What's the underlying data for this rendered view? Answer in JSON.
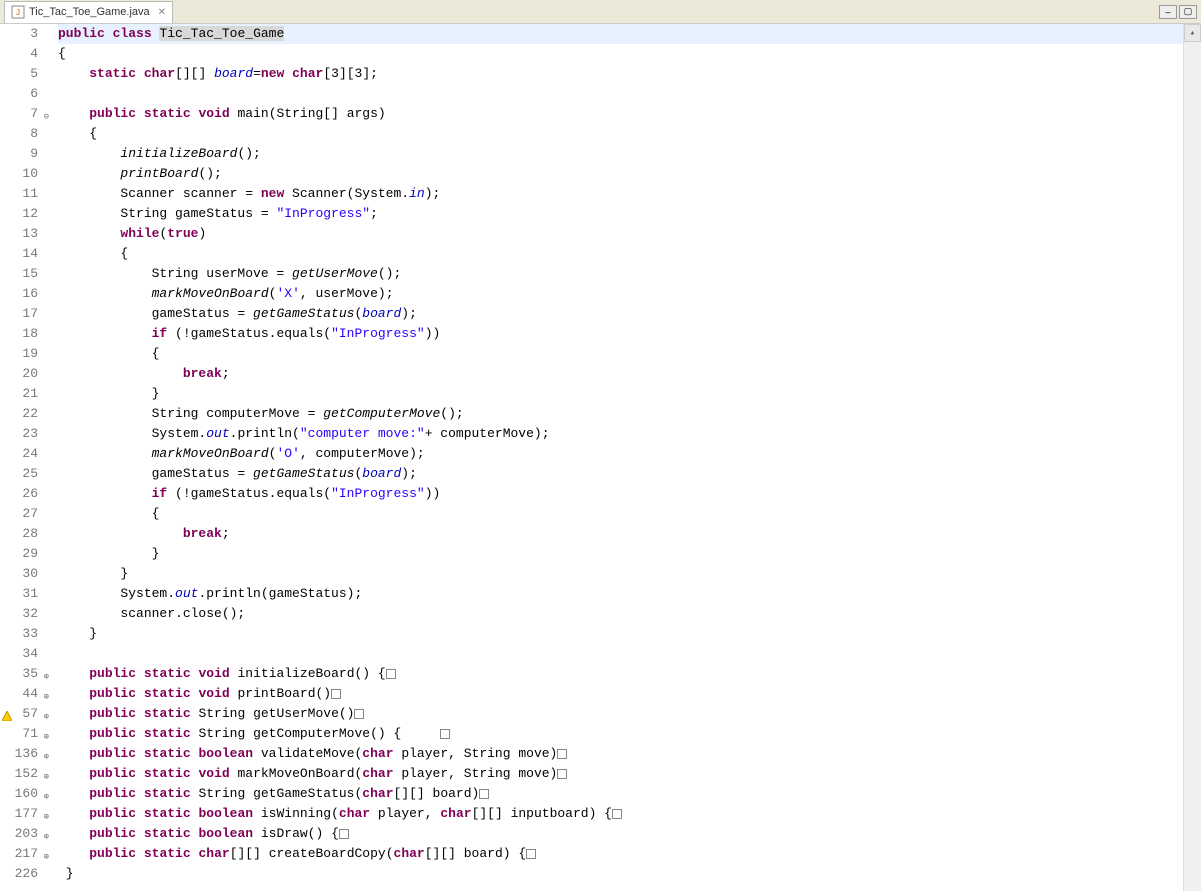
{
  "tab": {
    "title": "Tic_Tac_Toe_Game.java"
  },
  "code": {
    "lines": [
      {
        "n": "3",
        "fold": "",
        "hl": true,
        "tokens": [
          {
            "t": "public",
            "c": "kw"
          },
          {
            "t": " "
          },
          {
            "t": "class",
            "c": "kw"
          },
          {
            "t": " "
          },
          {
            "t": "Tic_Tac_Toe_Game",
            "c": "sel"
          }
        ]
      },
      {
        "n": "4",
        "tokens": [
          {
            "t": "{"
          }
        ]
      },
      {
        "n": "5",
        "tokens": [
          {
            "t": "    "
          },
          {
            "t": "static",
            "c": "kw"
          },
          {
            "t": " "
          },
          {
            "t": "char",
            "c": "kw"
          },
          {
            "t": "[][] "
          },
          {
            "t": "board",
            "c": "fld"
          },
          {
            "t": "="
          },
          {
            "t": "new",
            "c": "kw"
          },
          {
            "t": " "
          },
          {
            "t": "char",
            "c": "kw"
          },
          {
            "t": "[3][3];"
          }
        ]
      },
      {
        "n": "6",
        "tokens": [
          {
            "t": ""
          }
        ]
      },
      {
        "n": "7",
        "fold": "open",
        "tokens": [
          {
            "t": "    "
          },
          {
            "t": "public",
            "c": "kw"
          },
          {
            "t": " "
          },
          {
            "t": "static",
            "c": "kw"
          },
          {
            "t": " "
          },
          {
            "t": "void",
            "c": "kw"
          },
          {
            "t": " main(String[] args)"
          }
        ]
      },
      {
        "n": "8",
        "tokens": [
          {
            "t": "    {"
          }
        ]
      },
      {
        "n": "9",
        "tokens": [
          {
            "t": "        "
          },
          {
            "t": "initializeBoard",
            "c": "mtdi"
          },
          {
            "t": "();"
          }
        ]
      },
      {
        "n": "10",
        "tokens": [
          {
            "t": "        "
          },
          {
            "t": "printBoard",
            "c": "mtdi"
          },
          {
            "t": "();"
          }
        ]
      },
      {
        "n": "11",
        "tokens": [
          {
            "t": "        Scanner scanner = "
          },
          {
            "t": "new",
            "c": "kw"
          },
          {
            "t": " Scanner(System."
          },
          {
            "t": "in",
            "c": "fld"
          },
          {
            "t": ");"
          }
        ]
      },
      {
        "n": "12",
        "tokens": [
          {
            "t": "        String gameStatus = "
          },
          {
            "t": "\"InProgress\"",
            "c": "str"
          },
          {
            "t": ";"
          }
        ]
      },
      {
        "n": "13",
        "tokens": [
          {
            "t": "        "
          },
          {
            "t": "while",
            "c": "kw"
          },
          {
            "t": "("
          },
          {
            "t": "true",
            "c": "kw"
          },
          {
            "t": ")"
          }
        ]
      },
      {
        "n": "14",
        "tokens": [
          {
            "t": "        {"
          }
        ]
      },
      {
        "n": "15",
        "tokens": [
          {
            "t": "            String userMove = "
          },
          {
            "t": "getUserMove",
            "c": "mtdi"
          },
          {
            "t": "();"
          }
        ]
      },
      {
        "n": "16",
        "tokens": [
          {
            "t": "            "
          },
          {
            "t": "markMoveOnBoard",
            "c": "mtdi"
          },
          {
            "t": "("
          },
          {
            "t": "'X'",
            "c": "str"
          },
          {
            "t": ", userMove);"
          }
        ]
      },
      {
        "n": "17",
        "tokens": [
          {
            "t": "            gameStatus = "
          },
          {
            "t": "getGameStatus",
            "c": "mtdi"
          },
          {
            "t": "("
          },
          {
            "t": "board",
            "c": "fld"
          },
          {
            "t": ");"
          }
        ]
      },
      {
        "n": "18",
        "tokens": [
          {
            "t": "            "
          },
          {
            "t": "if",
            "c": "kw"
          },
          {
            "t": " (!gameStatus.equals("
          },
          {
            "t": "\"InProgress\"",
            "c": "str"
          },
          {
            "t": "))"
          }
        ]
      },
      {
        "n": "19",
        "tokens": [
          {
            "t": "            {"
          }
        ]
      },
      {
        "n": "20",
        "tokens": [
          {
            "t": "                "
          },
          {
            "t": "break",
            "c": "kw"
          },
          {
            "t": ";"
          }
        ]
      },
      {
        "n": "21",
        "tokens": [
          {
            "t": "            }"
          }
        ]
      },
      {
        "n": "22",
        "tokens": [
          {
            "t": "            String computerMove = "
          },
          {
            "t": "getComputerMove",
            "c": "mtdi"
          },
          {
            "t": "();"
          }
        ]
      },
      {
        "n": "23",
        "tokens": [
          {
            "t": "            System."
          },
          {
            "t": "out",
            "c": "fld"
          },
          {
            "t": ".println("
          },
          {
            "t": "\"computer move:\"",
            "c": "str"
          },
          {
            "t": "+ computerMove);"
          }
        ]
      },
      {
        "n": "24",
        "tokens": [
          {
            "t": "            "
          },
          {
            "t": "markMoveOnBoard",
            "c": "mtdi"
          },
          {
            "t": "("
          },
          {
            "t": "'O'",
            "c": "str"
          },
          {
            "t": ", computerMove);"
          }
        ]
      },
      {
        "n": "25",
        "tokens": [
          {
            "t": "            gameStatus = "
          },
          {
            "t": "getGameStatus",
            "c": "mtdi"
          },
          {
            "t": "("
          },
          {
            "t": "board",
            "c": "fld"
          },
          {
            "t": ");"
          }
        ]
      },
      {
        "n": "26",
        "tokens": [
          {
            "t": "            "
          },
          {
            "t": "if",
            "c": "kw"
          },
          {
            "t": " (!gameStatus.equals("
          },
          {
            "t": "\"InProgress\"",
            "c": "str"
          },
          {
            "t": "))"
          }
        ]
      },
      {
        "n": "27",
        "tokens": [
          {
            "t": "            {"
          }
        ]
      },
      {
        "n": "28",
        "tokens": [
          {
            "t": "                "
          },
          {
            "t": "break",
            "c": "kw"
          },
          {
            "t": ";"
          }
        ]
      },
      {
        "n": "29",
        "tokens": [
          {
            "t": "            }"
          }
        ]
      },
      {
        "n": "30",
        "tokens": [
          {
            "t": "        }"
          }
        ]
      },
      {
        "n": "31",
        "tokens": [
          {
            "t": "        System."
          },
          {
            "t": "out",
            "c": "fld"
          },
          {
            "t": ".println(gameStatus);"
          }
        ]
      },
      {
        "n": "32",
        "tokens": [
          {
            "t": "        scanner.close();"
          }
        ]
      },
      {
        "n": "33",
        "tokens": [
          {
            "t": "    }"
          }
        ]
      },
      {
        "n": "34",
        "tokens": [
          {
            "t": ""
          }
        ]
      },
      {
        "n": "35",
        "fold": "closed",
        "tokens": [
          {
            "t": "    "
          },
          {
            "t": "public",
            "c": "kw"
          },
          {
            "t": " "
          },
          {
            "t": "static",
            "c": "kw"
          },
          {
            "t": " "
          },
          {
            "t": "void",
            "c": "kw"
          },
          {
            "t": " initializeBoard() {"
          },
          {
            "t": "[]",
            "c": "fold-box-inline"
          }
        ]
      },
      {
        "n": "44",
        "fold": "closed",
        "tokens": [
          {
            "t": "    "
          },
          {
            "t": "public",
            "c": "kw"
          },
          {
            "t": " "
          },
          {
            "t": "static",
            "c": "kw"
          },
          {
            "t": " "
          },
          {
            "t": "void",
            "c": "kw"
          },
          {
            "t": " printBoard()"
          },
          {
            "t": "[]",
            "c": "fold-box-inline"
          }
        ]
      },
      {
        "n": "57",
        "fold": "closed",
        "warn": true,
        "tokens": [
          {
            "t": "    "
          },
          {
            "t": "public",
            "c": "kw"
          },
          {
            "t": " "
          },
          {
            "t": "static",
            "c": "kw"
          },
          {
            "t": " String getUserMove()"
          },
          {
            "t": "[]",
            "c": "fold-box-inline"
          }
        ]
      },
      {
        "n": "71",
        "fold": "closed",
        "tokens": [
          {
            "t": "    "
          },
          {
            "t": "public",
            "c": "kw"
          },
          {
            "t": " "
          },
          {
            "t": "static",
            "c": "kw"
          },
          {
            "t": " String getComputerMove() {     "
          },
          {
            "t": "[]",
            "c": "fold-box-inline"
          }
        ]
      },
      {
        "n": "136",
        "fold": "closed",
        "tokens": [
          {
            "t": "    "
          },
          {
            "t": "public",
            "c": "kw"
          },
          {
            "t": " "
          },
          {
            "t": "static",
            "c": "kw"
          },
          {
            "t": " "
          },
          {
            "t": "boolean",
            "c": "kw"
          },
          {
            "t": " validateMove("
          },
          {
            "t": "char",
            "c": "kw"
          },
          {
            "t": " player, String move)"
          },
          {
            "t": "[]",
            "c": "fold-box-inline"
          }
        ]
      },
      {
        "n": "152",
        "fold": "closed",
        "tokens": [
          {
            "t": "    "
          },
          {
            "t": "public",
            "c": "kw"
          },
          {
            "t": " "
          },
          {
            "t": "static",
            "c": "kw"
          },
          {
            "t": " "
          },
          {
            "t": "void",
            "c": "kw"
          },
          {
            "t": " markMoveOnBoard("
          },
          {
            "t": "char",
            "c": "kw"
          },
          {
            "t": " player, String move)"
          },
          {
            "t": "[]",
            "c": "fold-box-inline"
          }
        ]
      },
      {
        "n": "160",
        "fold": "closed",
        "tokens": [
          {
            "t": "    "
          },
          {
            "t": "public",
            "c": "kw"
          },
          {
            "t": " "
          },
          {
            "t": "static",
            "c": "kw"
          },
          {
            "t": " String getGameStatus("
          },
          {
            "t": "char",
            "c": "kw"
          },
          {
            "t": "[][] board)"
          },
          {
            "t": "[]",
            "c": "fold-box-inline"
          }
        ]
      },
      {
        "n": "177",
        "fold": "closed",
        "tokens": [
          {
            "t": "    "
          },
          {
            "t": "public",
            "c": "kw"
          },
          {
            "t": " "
          },
          {
            "t": "static",
            "c": "kw"
          },
          {
            "t": " "
          },
          {
            "t": "boolean",
            "c": "kw"
          },
          {
            "t": " isWinning("
          },
          {
            "t": "char",
            "c": "kw"
          },
          {
            "t": " player, "
          },
          {
            "t": "char",
            "c": "kw"
          },
          {
            "t": "[][] inputboard) {"
          },
          {
            "t": "[]",
            "c": "fold-box-inline"
          }
        ]
      },
      {
        "n": "203",
        "fold": "closed",
        "tokens": [
          {
            "t": "    "
          },
          {
            "t": "public",
            "c": "kw"
          },
          {
            "t": " "
          },
          {
            "t": "static",
            "c": "kw"
          },
          {
            "t": " "
          },
          {
            "t": "boolean",
            "c": "kw"
          },
          {
            "t": " isDraw() {"
          },
          {
            "t": "[]",
            "c": "fold-box-inline"
          }
        ]
      },
      {
        "n": "217",
        "fold": "closed",
        "tokens": [
          {
            "t": "    "
          },
          {
            "t": "public",
            "c": "kw"
          },
          {
            "t": " "
          },
          {
            "t": "static",
            "c": "kw"
          },
          {
            "t": " "
          },
          {
            "t": "char",
            "c": "kw"
          },
          {
            "t": "[][] createBoardCopy("
          },
          {
            "t": "char",
            "c": "kw"
          },
          {
            "t": "[][] board) {"
          },
          {
            "t": "[]",
            "c": "fold-box-inline"
          }
        ]
      },
      {
        "n": "226",
        "tokens": [
          {
            "t": " }"
          }
        ]
      }
    ]
  }
}
